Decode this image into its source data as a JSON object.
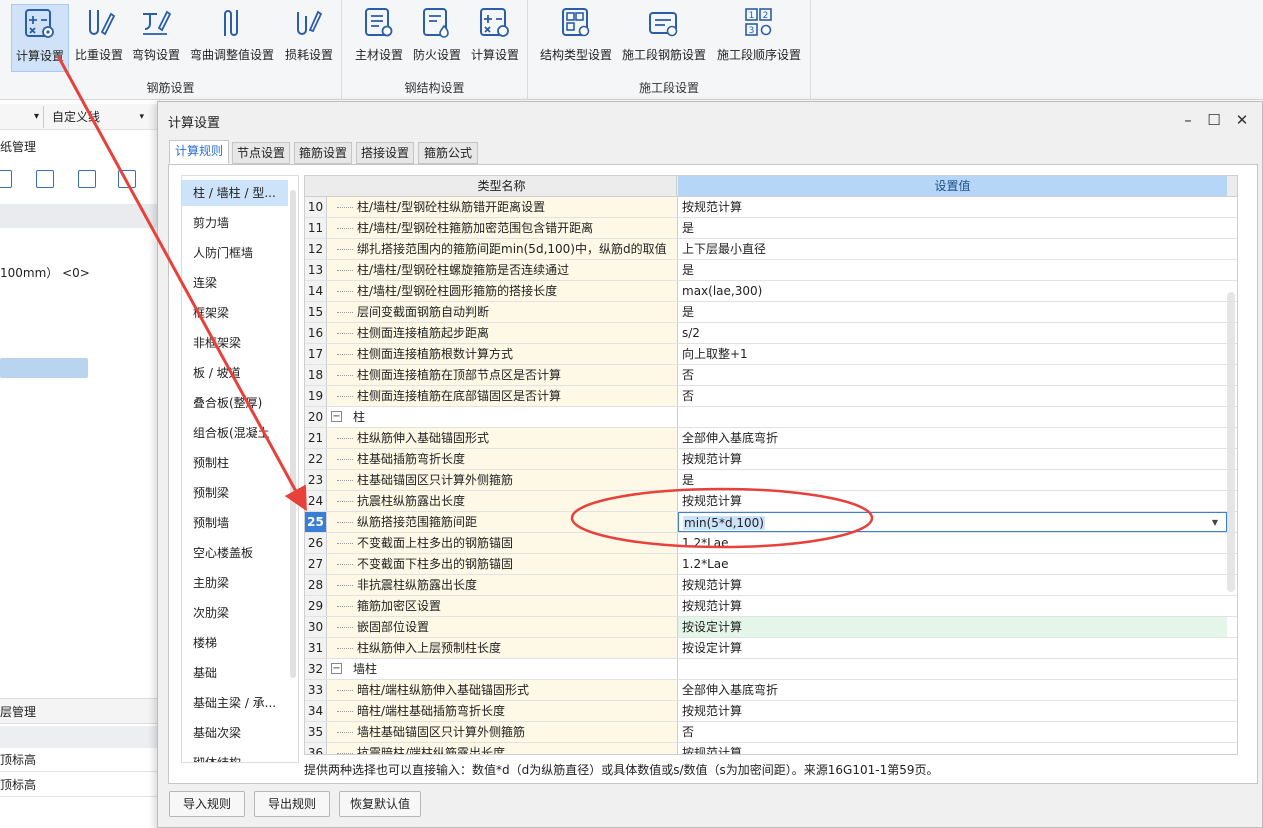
{
  "ribbon": {
    "groups": [
      {
        "label": "钢筋设置",
        "buttons": [
          "计算设置",
          "比重设置",
          "弯钩设置",
          "弯曲调整值设置",
          "损耗设置"
        ]
      },
      {
        "label": "钢结构设置",
        "buttons": [
          "主材设置",
          "防火设置",
          "计算设置"
        ]
      },
      {
        "label": "施工段设置",
        "buttons": [
          "结构类型设置",
          "施工段钢筋设置",
          "施工段顺序设置"
        ]
      }
    ]
  },
  "left_panel": {
    "dropdown": "自定义线",
    "drawing_manager": "纸管理",
    "value_text": "100mm）  <0>",
    "floor_manager": "层管理",
    "rows": [
      "顶标高",
      "顶标高"
    ]
  },
  "dialog": {
    "title": "计算设置",
    "tabs": [
      "计算规则",
      "节点设置",
      "箍筋设置",
      "搭接设置",
      "箍筋公式"
    ],
    "active_tab": "计算规则",
    "categories": [
      "柱 / 墙柱 / 型...",
      "剪力墙",
      "人防门框墙",
      "连梁",
      "框架梁",
      "非框架梁",
      "板 / 坡道",
      "叠合板(整厚)",
      "组合板(混凝土",
      "预制柱",
      "预制梁",
      "预制墙",
      "空心楼盖板",
      "主肋梁",
      "次肋梁",
      "楼梯",
      "基础",
      "基础主梁 / 承...",
      "基础次梁",
      "砌体结构"
    ],
    "selected_category": "柱 / 墙柱 / 型...",
    "grid": {
      "header_name": "类型名称",
      "header_value": "设置值",
      "rows": [
        {
          "num": "10",
          "name": "柱/墙柱/型钢砼柱纵筋错开距离设置",
          "value": "按规范计算"
        },
        {
          "num": "11",
          "name": "柱/墙柱/型钢砼柱箍筋加密范围包含错开距离",
          "value": "是"
        },
        {
          "num": "12",
          "name": "绑扎搭接范围内的箍筋间距min(5d,100)中，纵筋d的取值",
          "value": "上下层最小直径"
        },
        {
          "num": "13",
          "name": "柱/墙柱/型钢砼柱螺旋箍筋是否连续通过",
          "value": "是"
        },
        {
          "num": "14",
          "name": "柱/墙柱/型钢砼柱圆形箍筋的搭接长度",
          "value": "max(lae,300)"
        },
        {
          "num": "15",
          "name": "层间变截面钢筋自动判断",
          "value": "是"
        },
        {
          "num": "16",
          "name": "柱侧面连接植筋起步距离",
          "value": "s/2"
        },
        {
          "num": "17",
          "name": "柱侧面连接植筋根数计算方式",
          "value": "向上取整+1"
        },
        {
          "num": "18",
          "name": "柱侧面连接植筋在顶部节点区是否计算",
          "value": "否"
        },
        {
          "num": "19",
          "name": "柱侧面连接植筋在底部锚固区是否计算",
          "value": "否"
        },
        {
          "num": "20",
          "name": "柱",
          "value": "",
          "group": true
        },
        {
          "num": "21",
          "name": "柱纵筋伸入基础锚固形式",
          "value": "全部伸入基底弯折"
        },
        {
          "num": "22",
          "name": "柱基础插筋弯折长度",
          "value": "按规范计算"
        },
        {
          "num": "23",
          "name": "柱基础锚固区只计算外侧箍筋",
          "value": "是"
        },
        {
          "num": "24",
          "name": "抗震柱纵筋露出长度",
          "value": "按规范计算"
        },
        {
          "num": "25",
          "name": "纵筋搭接范围箍筋间距",
          "value": "min(5*d,100)",
          "editing": true
        },
        {
          "num": "26",
          "name": "不变截面上柱多出的钢筋锚固",
          "value": "1.2*Lae"
        },
        {
          "num": "27",
          "name": "不变截面下柱多出的钢筋锚固",
          "value": "1.2*Lae"
        },
        {
          "num": "28",
          "name": "非抗震柱纵筋露出长度",
          "value": "按规范计算"
        },
        {
          "num": "29",
          "name": "箍筋加密区设置",
          "value": "按规范计算"
        },
        {
          "num": "30",
          "name": "嵌固部位设置",
          "value": "按设定计算",
          "highlight": true
        },
        {
          "num": "31",
          "name": "柱纵筋伸入上层预制柱长度",
          "value": "按设定计算"
        },
        {
          "num": "32",
          "name": "墙柱",
          "value": "",
          "group": true
        },
        {
          "num": "33",
          "name": "暗柱/端柱纵筋伸入基础锚固形式",
          "value": "全部伸入基底弯折"
        },
        {
          "num": "34",
          "name": "暗柱/端柱基础插筋弯折长度",
          "value": "按规范计算"
        },
        {
          "num": "35",
          "name": "墙柱基础锚固区只计算外侧箍筋",
          "value": "否"
        },
        {
          "num": "36",
          "name": "抗震暗柱/端柱纵筋露出长度",
          "value": "按规范计算"
        }
      ]
    },
    "hint": "提供两种选择也可以直接输入：数值*d（d为纵筋直径）或具体数值或s/数值（s为加密间距）。来源16G101-1第59页。",
    "footer_buttons": [
      "导入规则",
      "导出规则",
      "恢复默认值"
    ]
  },
  "colors": {
    "accent": "#3a7fd5",
    "annotation_red": "#e8403a",
    "header_value_bg": "#b6d6f8",
    "child_row_bg": "#fdf9e6"
  }
}
